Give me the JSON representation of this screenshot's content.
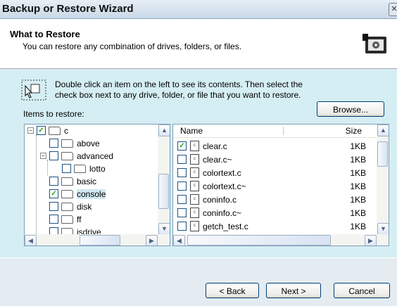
{
  "window": {
    "title": "Backup or Restore Wizard",
    "close_glyph": "✕"
  },
  "header": {
    "title": "What to Restore",
    "subtitle": "You can restore any combination of drives, folders, or files.",
    "icon": "backup-media-icon"
  },
  "instructions": {
    "icon": "pointer-selection-icon",
    "text": "Double click an item on the left to see its contents. Then select the check box next to any drive, folder, or file that you want to restore."
  },
  "items_label": "Items to restore:",
  "browse_label": "Browse...",
  "tree": {
    "items": [
      {
        "label": "c",
        "level": 0,
        "checked": true,
        "expander": "−"
      },
      {
        "label": "above",
        "level": 1,
        "checked": false,
        "expander": ""
      },
      {
        "label": "advanced",
        "level": 1,
        "checked": false,
        "expander": "−"
      },
      {
        "label": "lotto",
        "level": 2,
        "checked": false,
        "expander": ""
      },
      {
        "label": "basic",
        "level": 1,
        "checked": false,
        "expander": ""
      },
      {
        "label": "console",
        "level": 1,
        "checked": true,
        "expander": "",
        "selected": true
      },
      {
        "label": "disk",
        "level": 1,
        "checked": false,
        "expander": ""
      },
      {
        "label": "ff",
        "level": 1,
        "checked": false,
        "expander": ""
      },
      {
        "label": "isdrive",
        "level": 1,
        "checked": false,
        "expander": ""
      }
    ]
  },
  "files": {
    "columns": {
      "name": "Name",
      "size": "Size"
    },
    "rows": [
      {
        "name": "clear.c",
        "size": "1KB",
        "checked": true
      },
      {
        "name": "clear.c~",
        "size": "1KB",
        "checked": false
      },
      {
        "name": "colortext.c",
        "size": "1KB",
        "checked": false
      },
      {
        "name": "colortext.c~",
        "size": "1KB",
        "checked": false
      },
      {
        "name": "coninfo.c",
        "size": "1KB",
        "checked": false
      },
      {
        "name": "coninfo.c~",
        "size": "1KB",
        "checked": false
      },
      {
        "name": "getch_test.c",
        "size": "1KB",
        "checked": false
      }
    ]
  },
  "buttons": {
    "back": "< Back",
    "next": "Next >",
    "cancel": "Cancel"
  },
  "colors": {
    "content_bg": "#d5eef3",
    "footer_bg": "#e4ecf1",
    "border_blue": "#7f9db9"
  }
}
